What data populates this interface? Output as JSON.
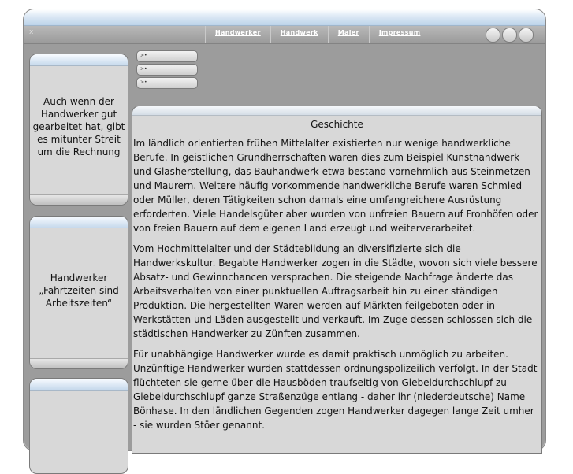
{
  "nav": {
    "items": [
      "Handwerker",
      "Handwerk",
      "Maler",
      "Impressum"
    ]
  },
  "window": {
    "close_glyph": "x"
  },
  "sidebar": {
    "boxes": [
      {
        "text": "Auch wenn der Handwerker gut gearbeitet hat, gibt es mitunter Streit um die Rechnung"
      },
      {
        "text": "Handwerker „Fahrtzeiten sind Arbeitszeiten“"
      },
      {
        "text": ""
      }
    ]
  },
  "small_buttons": [
    ">•",
    ">•",
    ">•"
  ],
  "article": {
    "title": "Geschichte",
    "paragraphs": [
      "Im ländlich orientierten frühen Mittelalter existierten nur wenige handwerkliche Berufe. In geistlichen Grundherrschaften waren dies zum Beispiel Kunsthandwerk und Glasherstellung, das Bauhandwerk etwa bestand vornehmlich aus Steinmetzen und Maurern. Weitere häufig vorkommende handwerkliche Berufe waren Schmied oder Müller, deren Tätigkeiten schon damals eine umfangreichere Ausrüstung erforderten. Viele Handelsgüter aber wurden von unfreien Bauern auf Fronhöfen oder von freien Bauern auf dem eigenen Land erzeugt und weiterverarbeitet.",
      "Vom Hochmittelalter und der Städtebildung an diversifizierte sich die Handwerkskultur. Begabte Handwerker zogen in die Städte, wovon sich viele bessere Absatz- und Gewinnchancen versprachen. Die steigende Nachfrage änderte das Arbeitsverhalten von einer punktuellen Auftragsarbeit hin zu einer ständigen Produktion. Die hergestellten Waren werden auf Märkten feilgeboten oder in Werkstätten und Läden ausgestellt und verkauft. Im Zuge dessen schlossen sich die städtischen Handwerker zu Zünften zusammen.",
      "Für unabhängige Handwerker wurde es damit praktisch unmöglich zu arbeiten. Unzünftige Handwerker wurden stattdessen ordnungspolizeilich verfolgt. In der Stadt flüchteten sie gerne über die Hausböden traufseitig von Giebeldurchschlupf zu Giebeldurchschlupf ganze Straßenzüge entlang - daher ihr (niederdeutsche) Name Bönhase. In den ländlichen Gegenden zogen Handwerker dagegen lange Zeit umher - sie wurden Stöer genannt."
    ]
  }
}
